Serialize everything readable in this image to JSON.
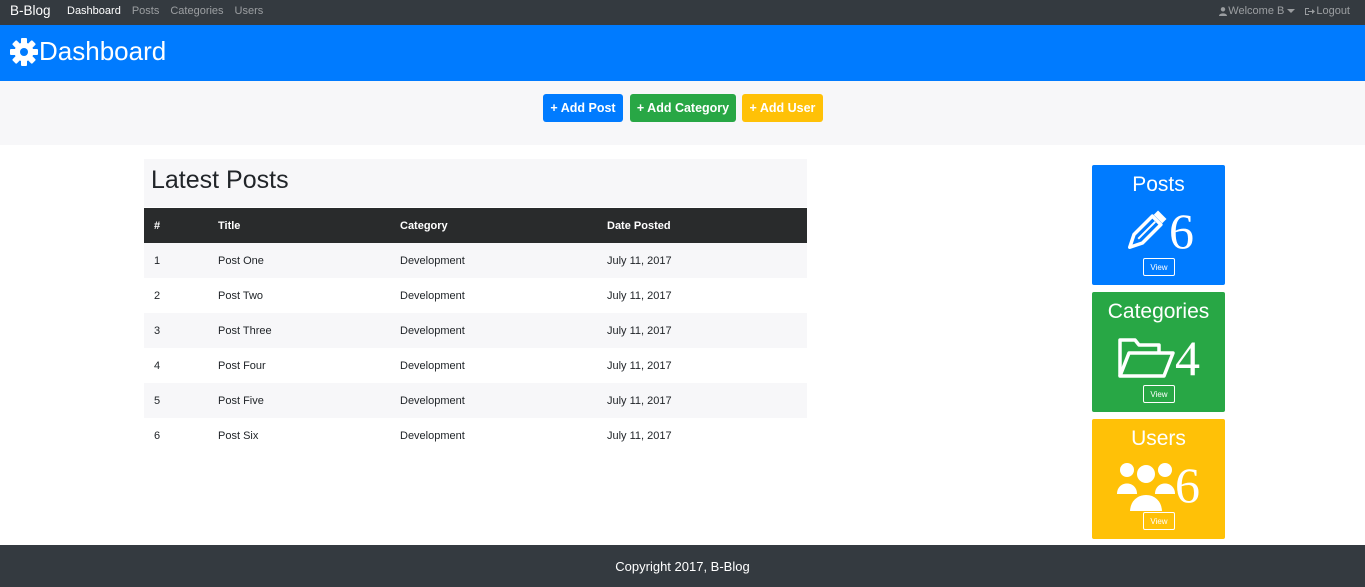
{
  "navbar": {
    "brand": "B-Blog",
    "links": [
      "Dashboard",
      "Posts",
      "Categories",
      "Users"
    ],
    "welcome": "Welcome B",
    "logout": "Logout"
  },
  "header": {
    "title": "Dashboard",
    "icon": "gear-icon"
  },
  "actions": {
    "add_post": "+ Add Post",
    "add_category": "+ Add Category",
    "add_user": "+ Add User"
  },
  "posts": {
    "heading": "Latest Posts",
    "columns": [
      "#",
      "Title",
      "Category",
      "Date Posted"
    ],
    "rows": [
      [
        "1",
        "Post One",
        "Development",
        "July 11, 2017"
      ],
      [
        "2",
        "Post Two",
        "Development",
        "July 11, 2017"
      ],
      [
        "3",
        "Post Three",
        "Development",
        "July 11, 2017"
      ],
      [
        "4",
        "Post Four",
        "Development",
        "July 11, 2017"
      ],
      [
        "5",
        "Post Five",
        "Development",
        "July 11, 2017"
      ],
      [
        "6",
        "Post Six",
        "Development",
        "July 11, 2017"
      ]
    ]
  },
  "cards": {
    "posts": {
      "title": "Posts",
      "count": "6",
      "view": "View",
      "icon": "pencil-icon"
    },
    "categories": {
      "title": "Categories",
      "count": "4",
      "view": "View",
      "icon": "folder-open-icon"
    },
    "users": {
      "title": "Users",
      "count": "6",
      "view": "View",
      "icon": "users-icon"
    }
  },
  "footer": {
    "text": "Copyright 2017, B-Blog"
  },
  "colors": {
    "primary": "#007bff",
    "success": "#28a745",
    "warning": "#ffc107",
    "dark": "#343a40"
  }
}
